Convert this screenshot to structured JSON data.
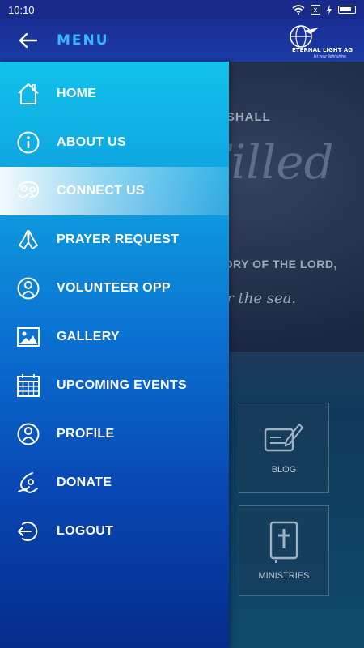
{
  "status_bar": {
    "time": "10:10",
    "notif": "x"
  },
  "app_bar": {
    "title": "MENU",
    "logo_text": "ETERNAL LIGHT AG",
    "logo_tagline": "let your light shine"
  },
  "banner": {
    "line1": "FOR THE EARTH SHALL",
    "line2": "Be Filled",
    "line3": "WITH THE KNOWLEDGE OF THE GLORY OF THE LORD,",
    "line4": "as the waters cover the sea."
  },
  "tiles": {
    "blog": "BLOG",
    "ministries": "MINISTRIES"
  },
  "menu": {
    "items": [
      {
        "label": "HOME",
        "icon": "home-icon"
      },
      {
        "label": "ABOUT US",
        "icon": "info-icon"
      },
      {
        "label": "CONNECT US",
        "icon": "connect-icon"
      },
      {
        "label": "PRAYER REQUEST",
        "icon": "praying-hands-icon"
      },
      {
        "label": "VOLUNTEER OPP",
        "icon": "volunteer-icon"
      },
      {
        "label": "GALLERY",
        "icon": "gallery-icon"
      },
      {
        "label": "UPCOMING EVENTS",
        "icon": "calendar-icon"
      },
      {
        "label": "PROFILE",
        "icon": "profile-icon"
      },
      {
        "label": "DONATE",
        "icon": "donate-icon"
      },
      {
        "label": "LOGOUT",
        "icon": "logout-icon"
      }
    ],
    "active_index": 2
  },
  "colors": {
    "drawer_top": "#12c2ea",
    "drawer_bottom": "#062c8c",
    "app_bar": "#1b2f96",
    "menu_title": "#38b8ff"
  }
}
